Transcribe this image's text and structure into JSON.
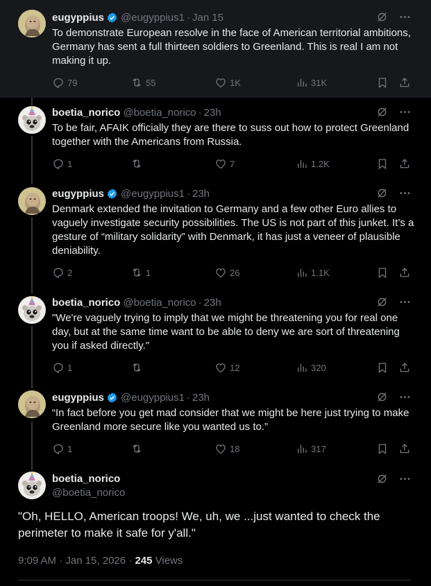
{
  "tweets": [
    {
      "author": "eugyppius",
      "handle": "@eugyppius1",
      "verified": true,
      "time": "Jan 15",
      "text": "To demonstrate European resolve in the face of American territorial ambitions, Germany has sent a full thirteen soldiers to Greenland. This is real I am not making it up.",
      "replies": "79",
      "reposts": "55",
      "likes": "1K",
      "views": "31K"
    },
    {
      "author": "boetia_norico",
      "handle": "@boetia_norico",
      "verified": false,
      "time": "23h",
      "text": "To be fair, AFAIK officially they are there to suss out how to protect Greenland together with the Americans from Russia.",
      "replies": "1",
      "reposts": "",
      "likes": "7",
      "views": "1.2K"
    },
    {
      "author": "eugyppius",
      "handle": "@eugyppius1",
      "verified": true,
      "time": "23h",
      "text": "Denmark extended the invitation to Germany and a few other Euro allies to vaguely investigate security possibilities. The US is not part of this junket. It’s a gesture of “military solidarity” with Denmark, it has just a veneer of plausible deniability.",
      "replies": "2",
      "reposts": "1",
      "likes": "26",
      "views": "1.1K"
    },
    {
      "author": "boetia_norico",
      "handle": "@boetia_norico",
      "verified": false,
      "time": "23h",
      "text": "\"We're vaguely trying to imply that we might be threatening you for real one day, but at the same time want to be able to deny we are sort of threatening you if asked directly.\"",
      "replies": "1",
      "reposts": "",
      "likes": "12",
      "views": "320"
    },
    {
      "author": "eugyppius",
      "handle": "@eugyppius1",
      "verified": true,
      "time": "23h",
      "text": "“In fact before you get mad consider that we might be here just trying to make Greenland more secure like you wanted us to.”",
      "replies": "1",
      "reposts": "",
      "likes": "18",
      "views": "317"
    }
  ],
  "main_tweet": {
    "author": "boetia_norico",
    "handle": "@boetia_norico",
    "text": "\"Oh, HELLO, American troops! We, uh, we ...just wanted to check the perimeter to make it safe for y'all.\"",
    "timestamp": "9:09 AM · Jan 15, 2026 · ",
    "views_count": "245",
    "views_label": " Views"
  },
  "icons": {
    "reply": "reply-icon",
    "repost": "repost-icon",
    "like": "heart-icon",
    "views": "views-icon",
    "bookmark": "bookmark-icon",
    "share": "share-icon",
    "grok": "grok-icon",
    "more": "more-icon",
    "verified": "verified-badge-icon"
  },
  "colors": {
    "background": "#000000",
    "first_tweet_bg": "#16181c",
    "text": "#e7e9ea",
    "muted": "#71767b",
    "verified": "#1d9bf0"
  }
}
